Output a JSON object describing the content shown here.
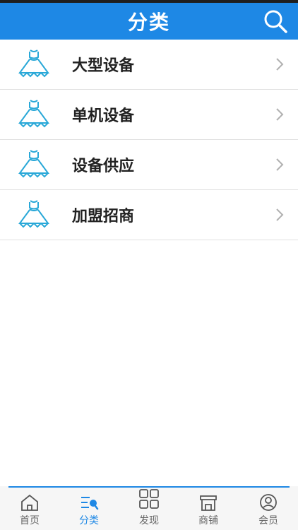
{
  "header": {
    "title": "分类"
  },
  "categories": [
    {
      "label": "大型设备"
    },
    {
      "label": "单机设备"
    },
    {
      "label": "设备供应"
    },
    {
      "label": "加盟招商"
    }
  ],
  "tabbar": {
    "tabs": [
      {
        "label": "首页",
        "icon": "home-icon"
      },
      {
        "label": "分类",
        "icon": "category-icon",
        "active": true
      },
      {
        "label": "发现",
        "icon": "grid-icon"
      },
      {
        "label": "商铺",
        "icon": "store-icon"
      },
      {
        "label": "会员",
        "icon": "user-icon"
      }
    ]
  },
  "colors": {
    "primary": "#1e88e5",
    "icon_teal": "#29a8d8",
    "text": "#222222",
    "tab_text": "#666666"
  }
}
